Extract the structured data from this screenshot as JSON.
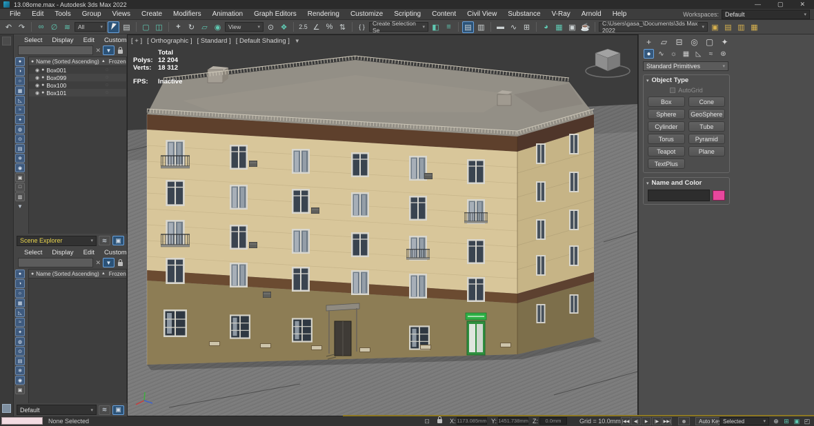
{
  "colors": {
    "accent_blue": "#2b5277",
    "accent_blue_border": "#6aa2dc",
    "explorer_picker_yellow": "#e8d44d",
    "name_color_swatch": "#e8479d",
    "active_viewport_strip": "#8d7823"
  },
  "window": {
    "title": "13.08ome.max - Autodesk 3ds Max 2022",
    "minimize": "—",
    "maximize": "▢",
    "close": "✕"
  },
  "menubar": {
    "items": [
      "File",
      "Edit",
      "Tools",
      "Group",
      "Views",
      "Create",
      "Modifiers",
      "Animation",
      "Graph Editors",
      "Rendering",
      "Customize",
      "Scripting",
      "Content",
      "Civil View",
      "Substance",
      "V-Ray",
      "Arnold",
      "Help"
    ],
    "workspaces_label": "Workspaces:",
    "workspace_value": "Default"
  },
  "icons": {
    "dropdown": "▾",
    "undo": "↶",
    "redo": "↷",
    "link": "∞",
    "unlink": "∅",
    "bind_spacewarp": "≋",
    "select_by_name": "▤",
    "region": "▢",
    "window_crossing": "◫",
    "move": "+",
    "rotate": "↻",
    "scale": "▱",
    "place": "◉",
    "pivot": "⊙",
    "manipulate": "❖",
    "snaps": "2.5",
    "angle_snap": "∠",
    "percent_snap": "%",
    "spinner_snap": "⇅",
    "named_sets": "{ }",
    "mirror": "◧",
    "align": "≡",
    "scene_explorer": "▤",
    "layer_explorer": "▥",
    "ribbon": "▬",
    "curve_editor": "∿",
    "schematic": "⊞",
    "material": "◕",
    "render_setup": "▦",
    "rfw": "▣",
    "render": "☕",
    "render_a": "▣",
    "render_b": "▤",
    "render_c": "▥",
    "render_d": "▦",
    "funnel": "▼",
    "sort_asc": "▲",
    "clear": "✕",
    "eye": "◉",
    "dot": "●",
    "frozen": "◌",
    "stack": "≋",
    "explorer_box": "▣",
    "isolate": "⊡",
    "viewcube": "view-cube",
    "axis_gizmo": "axis-tripod"
  },
  "toolbar": {
    "selection_filter_value": "All",
    "coord_system_value": "View",
    "named_sets_value": "Create Selection Se",
    "project_path_value": "C:\\Users\\gasa_\\Documents\\3ds Max 2022"
  },
  "explorer": {
    "menu": [
      "Select",
      "Display",
      "Edit",
      "Customize"
    ],
    "columns": {
      "name": "Name (Sorted Ascending)",
      "frozen": "Frozen"
    },
    "rows": [
      "Box001",
      "Box099",
      "Box100",
      "Box101"
    ],
    "strip": [
      "●",
      "◑",
      "☼",
      "▦",
      "◺",
      "≈",
      "✦",
      "◍",
      "⊙",
      "▤",
      "❄",
      "◉"
    ],
    "strip_gray": [
      "▣",
      "□",
      "▥"
    ]
  },
  "pickers": {
    "top_value": "Scene Explorer",
    "bottom_value": "Default"
  },
  "viewport": {
    "label": {
      "plus": "[ + ]",
      "pov": "[ Orthographic ]",
      "style": "[ Standard ]",
      "shading": "[ Default Shading ]"
    },
    "stats": {
      "total": "Total",
      "polys_label": "Polys:",
      "polys": "12 204",
      "verts_label": "Verts:",
      "verts": "18 312",
      "fps_label": "FPS:",
      "fps": "Inactive"
    }
  },
  "command_panel": {
    "tabs": [
      "+",
      "▱",
      "⊟",
      "◎",
      "▢",
      "✦"
    ],
    "categories": [
      "●",
      "∿",
      "☼",
      "▦",
      "◺",
      "≈",
      "⊛"
    ],
    "dropdown_value": "Standard Primitives",
    "object_type": {
      "title": "Object Type",
      "autogrid": "AutoGrid",
      "buttons": [
        "Box",
        "Cone",
        "Sphere",
        "GeoSphere",
        "Cylinder",
        "Tube",
        "Torus",
        "Pyramid",
        "Teapot",
        "Plane",
        "TextPlus"
      ]
    },
    "name_color": {
      "title": "Name and Color",
      "name_value": ""
    }
  },
  "statusbar": {
    "none_selected": "None Selected",
    "x_label": "X:",
    "x_value": "1173.085mm",
    "y_label": "Y:",
    "y_value": "1451.738mm",
    "z_label": "Z:",
    "z_value": "0.0mm",
    "grid_label": "Grid = 10.0mm",
    "transport": [
      "|◀◀",
      "◀|",
      "▶",
      "|▶",
      "▶▶|"
    ],
    "auto_key": "Auto Key",
    "selection_set_value": "Selected",
    "nav": [
      "⊕",
      "⊞",
      "▣",
      "◰"
    ]
  }
}
